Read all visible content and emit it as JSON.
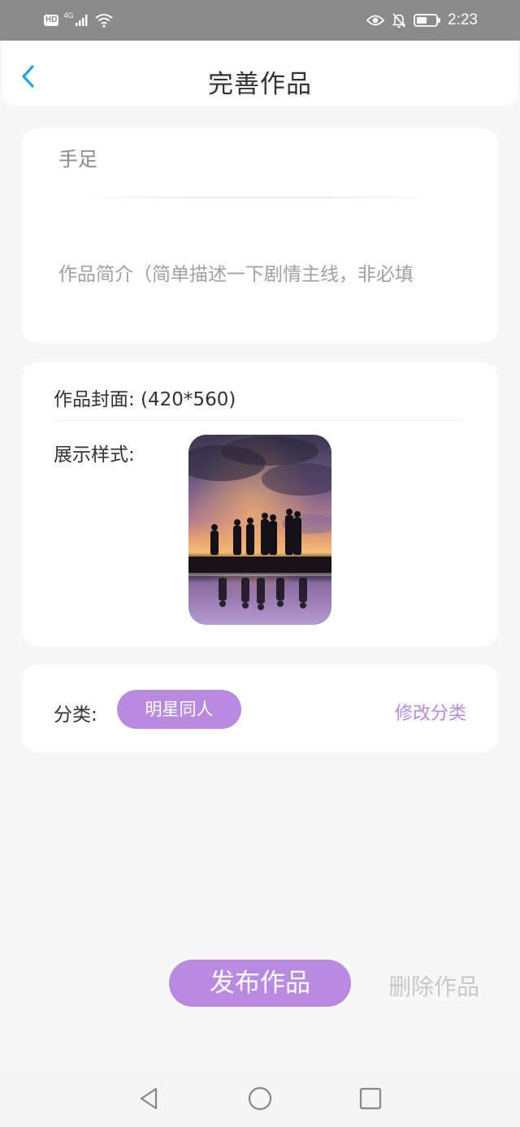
{
  "status_bar": {
    "hd": "HD",
    "network": "4G",
    "time": "2:23",
    "icons": [
      "signal-icon",
      "wifi-icon",
      "eye-icon",
      "bell-off-icon",
      "battery-icon"
    ]
  },
  "header": {
    "title": "完善作品",
    "back_icon": "chevron-left-icon",
    "accent_color": "#2aa0e8"
  },
  "title_card": {
    "title_value": "手足",
    "intro_placeholder": "作品简介（简单描述一下剧情主线，非必填"
  },
  "cover_card": {
    "cover_label": "作品封面: (420*560)",
    "display_label": "展示样式:",
    "cover_image": "silhouettes-at-sunset-reflection"
  },
  "category_card": {
    "label": "分类:",
    "tag": "明星同人",
    "edit_label": "修改分类"
  },
  "actions": {
    "publish_label": "发布作品",
    "delete_label": "删除作品"
  },
  "theme": {
    "brand_purple": "#b98be0",
    "background": "#f7f7f7"
  },
  "nav_bar": {
    "icons": [
      "back-triangle-icon",
      "home-circle-icon",
      "recents-square-icon"
    ]
  }
}
